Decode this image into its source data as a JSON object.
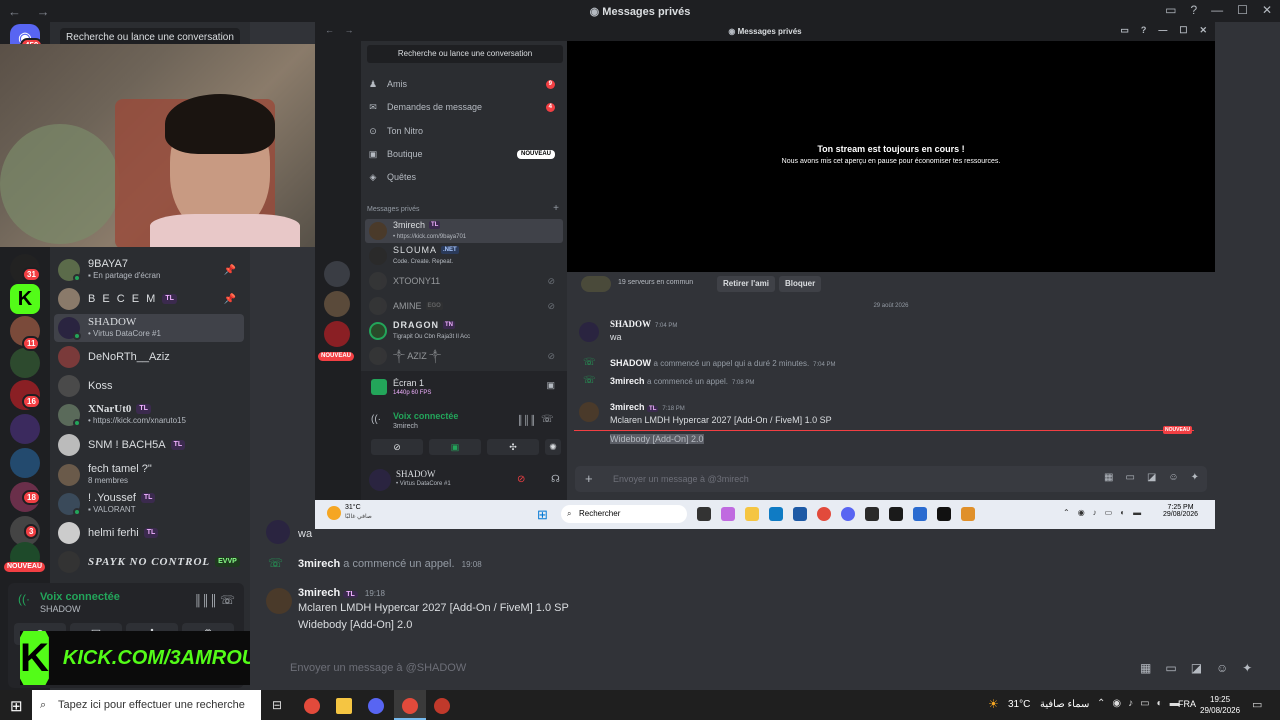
{
  "window": {
    "title": "Messages privés",
    "nav": "← →"
  },
  "left": {
    "search": "Recherche ou lance une conversation",
    "discord_badge": "450",
    "server_badges": [
      "31",
      "11",
      "16",
      "18",
      "3"
    ],
    "nouveau": "NOUVEAU",
    "dms": [
      {
        "name": "9BAYA7",
        "sub": "En partage d'écran",
        "tag": "",
        "pinned": true
      },
      {
        "name": "B E C E M",
        "sub": "",
        "tag": "TL",
        "pinned": true
      },
      {
        "name": "SHADOW",
        "sub": "• Virtus DataCore #1",
        "tag": "",
        "active": true
      },
      {
        "name": "DeNoRTh__Aziz",
        "sub": "",
        "tag": ""
      },
      {
        "name": "Koss",
        "sub": "",
        "tag": ""
      },
      {
        "name": "XNarUt0",
        "sub": "• https://kick.com/xnaruto15",
        "tag": "TL"
      },
      {
        "name": "SNM ! BACH5A",
        "sub": "",
        "tag": "TL"
      },
      {
        "name": "fech tamel ?\"",
        "sub": "8 membres",
        "tag": ""
      },
      {
        "name": "! .Youssef",
        "sub": "VALORANT",
        "tag": "TL"
      },
      {
        "name": "helmi ferhi",
        "sub": "",
        "tag": "TL"
      },
      {
        "name": "SPAYK NO CONTROL",
        "sub": "",
        "tag": "EVVP"
      }
    ],
    "voice": {
      "status": "Voix connectée",
      "channel": "SHADOW"
    },
    "kick": {
      "logo": "K",
      "text": "KICK.COM/3AMROUCH"
    }
  },
  "main": {
    "partial_msg": "wa",
    "call_notice": {
      "name": "3mirech",
      "text": "a commencé un appel.",
      "time": "19:08"
    },
    "post": {
      "name": "3mirech",
      "tag": "TL",
      "time": "19:18",
      "line1": "Mclaren LMDH Hypercar 2027 [Add-On / FiveM] 1.0 SP",
      "line2": "Widebody [Add-On] 2.0"
    },
    "composer_placeholder": "Envoyer un message à @SHADOW"
  },
  "inner": {
    "title": "Messages privés",
    "search": "Recherche ou lance une conversation",
    "nav": [
      {
        "label": "Amis",
        "count": "9"
      },
      {
        "label": "Demandes de message",
        "count": "4"
      },
      {
        "label": "Ton Nitro",
        "count": ""
      },
      {
        "label": "Boutique",
        "new": "NOUVEAU"
      },
      {
        "label": "Quêtes",
        "count": ""
      }
    ],
    "dm_header": "Messages privés",
    "dms": [
      {
        "name": "3mirech",
        "tag": "TL",
        "sub": "• https://kick.com/9baya701",
        "active": true
      },
      {
        "name": "SLOUMA",
        "tag": ".NET",
        "sub": "Code. Create. Repeat."
      },
      {
        "name": "XTOONY11",
        "tag": "",
        "sub": ""
      },
      {
        "name": "AMINE",
        "tag": "EGO",
        "sub": ""
      },
      {
        "name": "DRAGON",
        "tag": "TN",
        "sub": "Tigrapit Ou Cbn Raja3t Il Acc"
      },
      {
        "name": "༒ AZIZ ༒",
        "tag": "",
        "sub": ""
      }
    ],
    "screen": {
      "label": "Écran 1",
      "quality": "1440p 60 FPS"
    },
    "voice": {
      "status": "Voix connectée",
      "channel": "3mirech"
    },
    "user": {
      "name": "SHADOW",
      "sub": "• Virtus DataCore #1"
    },
    "nouveau": "NOUVEAU",
    "stream": {
      "title": "Ton stream est toujours en cours !",
      "sub": "Nous avons mis cet aperçu en pause pour économiser tes ressources."
    },
    "friend_bar": {
      "mutual": "19 serveurs en commun",
      "remove": "Retirer l'ami",
      "block": "Bloquer"
    },
    "date_divider": "29 août 2026",
    "messages": {
      "m1": {
        "name": "SHADOW",
        "time": "7:04 PM",
        "text": "wa"
      },
      "m2": {
        "name": "SHADOW",
        "text": "a commencé un appel qui a duré 2 minutes.",
        "time": "7:04 PM"
      },
      "m3": {
        "name": "3mirech",
        "text": "a commencé un appel.",
        "time": "7:08 PM"
      },
      "m4": {
        "name": "3mirech",
        "tag": "TL",
        "time": "7:18 PM",
        "line1": "Mclaren LMDH Hypercar 2027 [Add-On / FiveM] 1.0 SP",
        "line2": "Widebody [Add-On] 2.0"
      }
    },
    "new_badge": "NOUVEAU",
    "composer": "Envoyer un message à @3mirech",
    "taskbar": {
      "weather": "31°C",
      "weather_sub": "صافي غالبًا",
      "search": "Rechercher",
      "time": "7:25 PM",
      "date": "29/08/2026"
    }
  },
  "taskbar": {
    "search": "Tapez ici pour effectuer une recherche",
    "weather": "31°C",
    "weather_desc": "سماء صافية",
    "lang": "FRA",
    "time": "19:25",
    "date": "29/08/2026"
  }
}
